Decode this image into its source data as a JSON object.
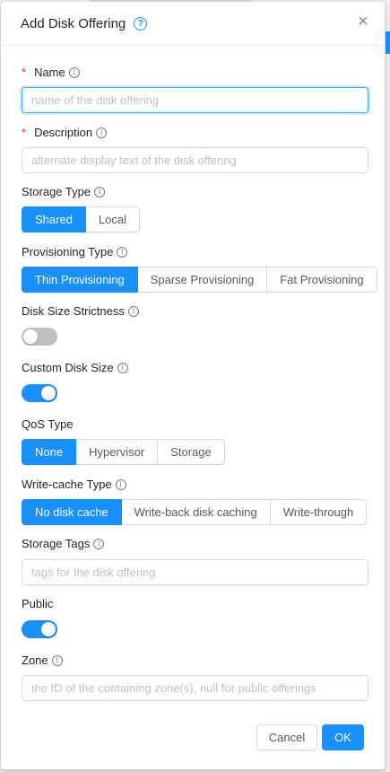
{
  "dialog": {
    "title": "Add Disk Offering",
    "close_glyph": "×",
    "help_glyph": "?"
  },
  "fields": {
    "name": {
      "label": "Name",
      "placeholder": "name of the disk offering",
      "value": ""
    },
    "description": {
      "label": "Description",
      "placeholder": "alternate display text of the disk offering",
      "value": ""
    },
    "storage_type": {
      "label": "Storage Type",
      "options": [
        "Shared",
        "Local"
      ],
      "selected": "Shared"
    },
    "provisioning_type": {
      "label": "Provisioning Type",
      "options": [
        "Thin Provisioning",
        "Sparse Provisioning",
        "Fat Provisioning"
      ],
      "selected": "Thin Provisioning"
    },
    "disk_size_strictness": {
      "label": "Disk Size Strictness",
      "enabled": false
    },
    "custom_disk_size": {
      "label": "Custom Disk Size",
      "enabled": true
    },
    "qos_type": {
      "label": "QoS Type",
      "options": [
        "None",
        "Hypervisor",
        "Storage"
      ],
      "selected": "None"
    },
    "write_cache_type": {
      "label": "Write-cache Type",
      "options": [
        "No disk cache",
        "Write-back disk caching",
        "Write-through"
      ],
      "selected": "No disk cache"
    },
    "storage_tags": {
      "label": "Storage Tags",
      "placeholder": "tags for the disk offering",
      "value": ""
    },
    "public": {
      "label": "Public",
      "enabled": true
    },
    "zone": {
      "label": "Zone",
      "placeholder": "the ID of the containing zone(s), null for public offerings",
      "value": ""
    }
  },
  "footer": {
    "cancel_label": "Cancel",
    "ok_label": "OK"
  },
  "icons": {
    "required_marker": "*",
    "info_glyph": "i"
  },
  "colors": {
    "accent": "#1890ff",
    "required": "#f5222d"
  }
}
